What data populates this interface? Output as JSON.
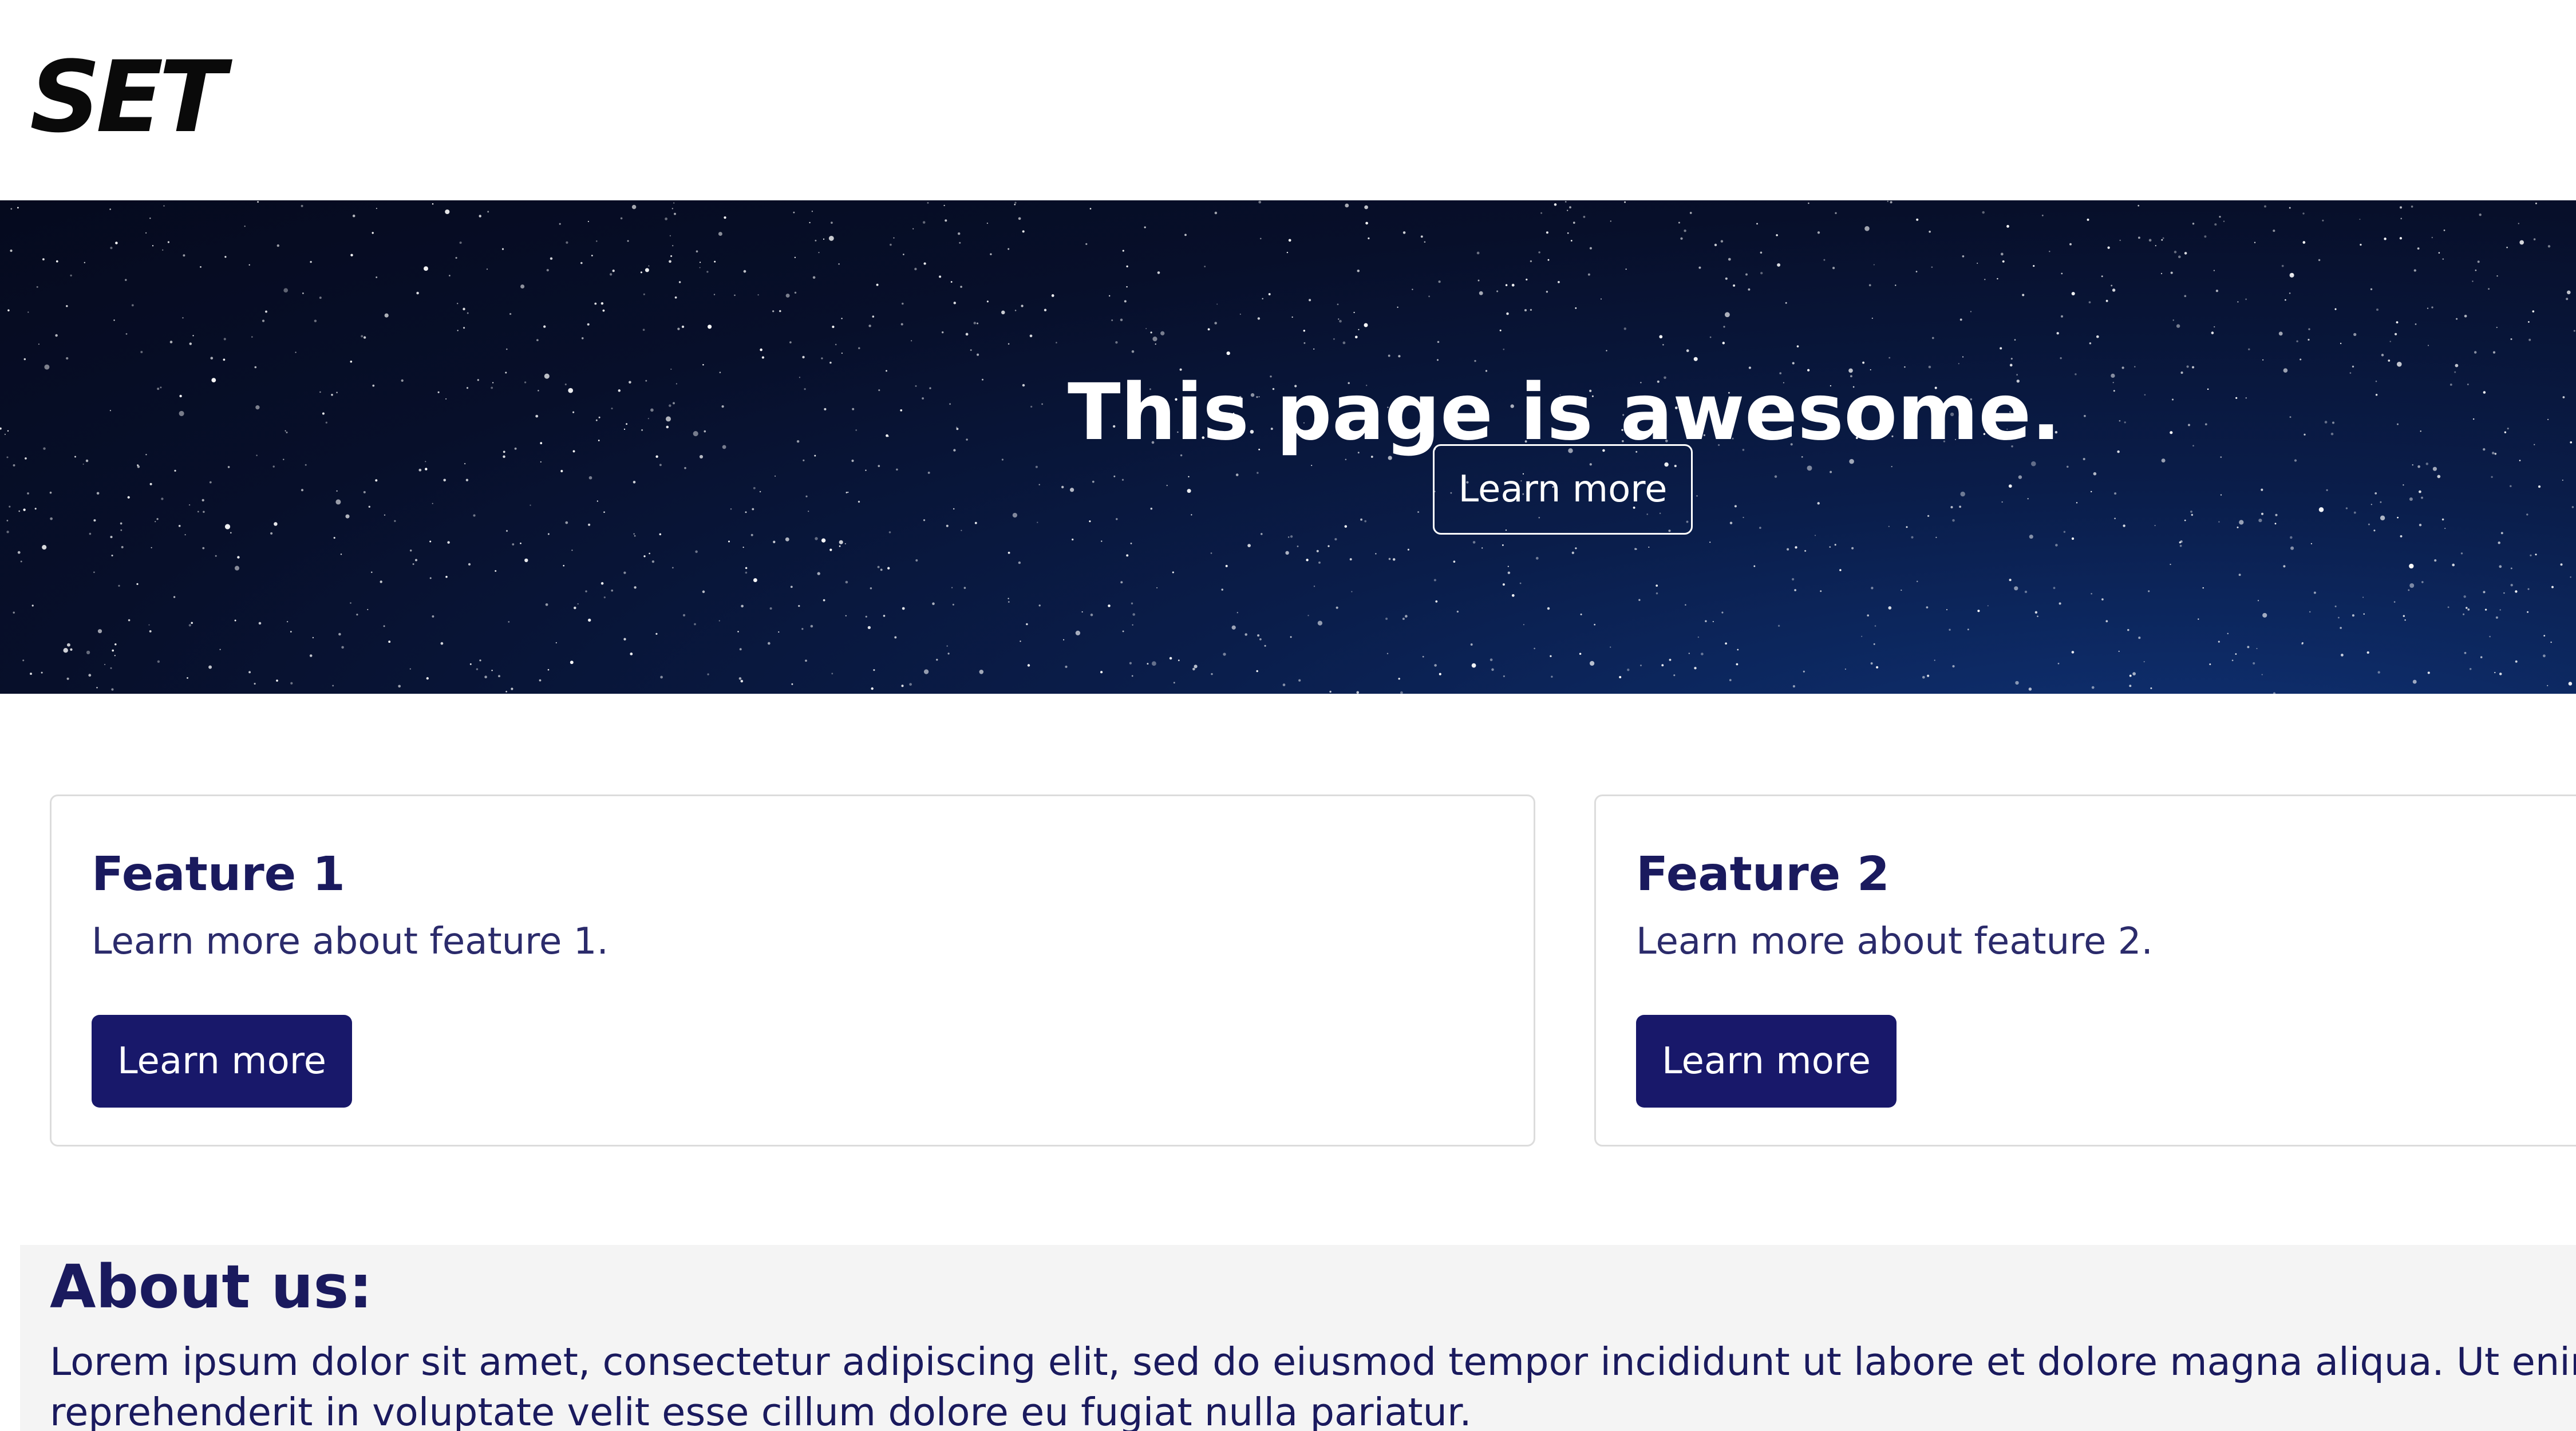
{
  "header": {
    "logo": "SET"
  },
  "hero": {
    "title": "This page is awesome.",
    "button_label": "Learn more"
  },
  "features": [
    {
      "title": "Feature 1",
      "description": "Learn more about feature 1.",
      "button_label": "Learn more"
    },
    {
      "title": "Feature 2",
      "description": "Learn more about feature 2.",
      "button_label": "Learn more"
    }
  ],
  "about": {
    "title": "About us:",
    "text": "Lorem ipsum dolor sit amet, consectetur adipiscing elit, sed do eiusmod tempor incididunt ut labore et dolore magna aliqua. Ut enim ad minim veniam, quis nostrud exercitation ullamco laboris nisi ut aliquip ex ea commodo consequat. Duis aute irure dolor in reprehenderit in voluptate velit esse cillum dolore eu fugiat nulla pariatur."
  },
  "colors": {
    "primary": "#18186a",
    "heading": "#1a1a5e",
    "hero_background": "#070f2a",
    "about_background": "#f4f4f4"
  }
}
